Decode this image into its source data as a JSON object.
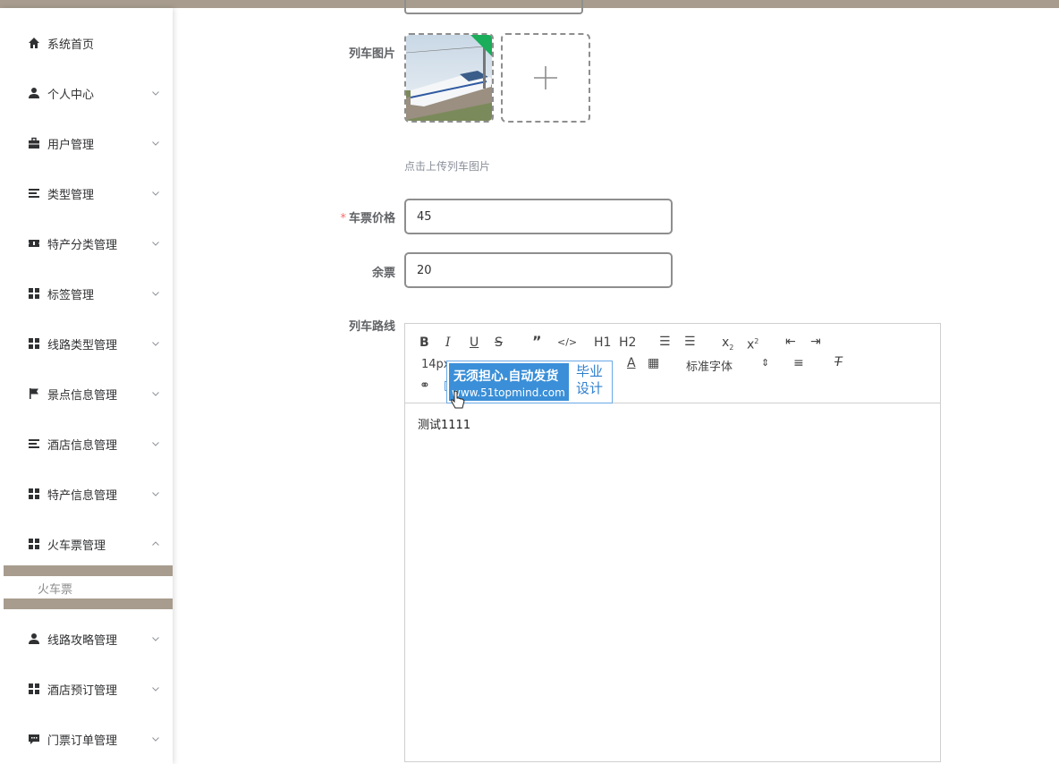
{
  "sidebar": {
    "items": [
      {
        "label": "系统首页",
        "icon": "home-icon",
        "has_arrow": false
      },
      {
        "label": "个人中心",
        "icon": "user-icon",
        "has_arrow": true
      },
      {
        "label": "用户管理",
        "icon": "briefcase-icon",
        "has_arrow": true
      },
      {
        "label": "类型管理",
        "icon": "list-icon",
        "has_arrow": true
      },
      {
        "label": "特产分类管理",
        "icon": "ticket-icon",
        "has_arrow": true
      },
      {
        "label": "标签管理",
        "icon": "grid-icon",
        "has_arrow": true
      },
      {
        "label": "线路类型管理",
        "icon": "grid-icon",
        "has_arrow": true
      },
      {
        "label": "景点信息管理",
        "icon": "flag-icon",
        "has_arrow": true
      },
      {
        "label": "酒店信息管理",
        "icon": "list-icon",
        "has_arrow": true
      },
      {
        "label": "特产信息管理",
        "icon": "grid-icon",
        "has_arrow": true
      },
      {
        "label": "火车票管理",
        "icon": "grid-icon",
        "has_arrow": true,
        "expanded": true
      },
      {
        "label": "线路攻略管理",
        "icon": "user-icon",
        "has_arrow": true
      },
      {
        "label": "酒店预订管理",
        "icon": "grid-icon",
        "has_arrow": true
      },
      {
        "label": "门票订单管理",
        "icon": "chat-icon",
        "has_arrow": true
      }
    ],
    "sub_item": "火车票"
  },
  "form": {
    "image_label": "列车图片",
    "upload_hint": "点击上传列车图片",
    "price_label": "车票价格",
    "price_value": "45",
    "stock_label": "余票",
    "stock_value": "20",
    "route_label": "列车路线",
    "required_mark": "*"
  },
  "editor": {
    "font_size": "14px",
    "font_family": "标准字体",
    "heading1": "H1",
    "heading2": "H2",
    "content": "测试1111"
  },
  "watermark": {
    "line1": "无须担心.自动发货",
    "line2": "www.51topmind.com",
    "right1": "毕业",
    "right2": "设计"
  },
  "colors": {
    "accent_bar": "#a79c8e",
    "badge_blue": "#3a8fd8",
    "required": "#f56c6c"
  }
}
